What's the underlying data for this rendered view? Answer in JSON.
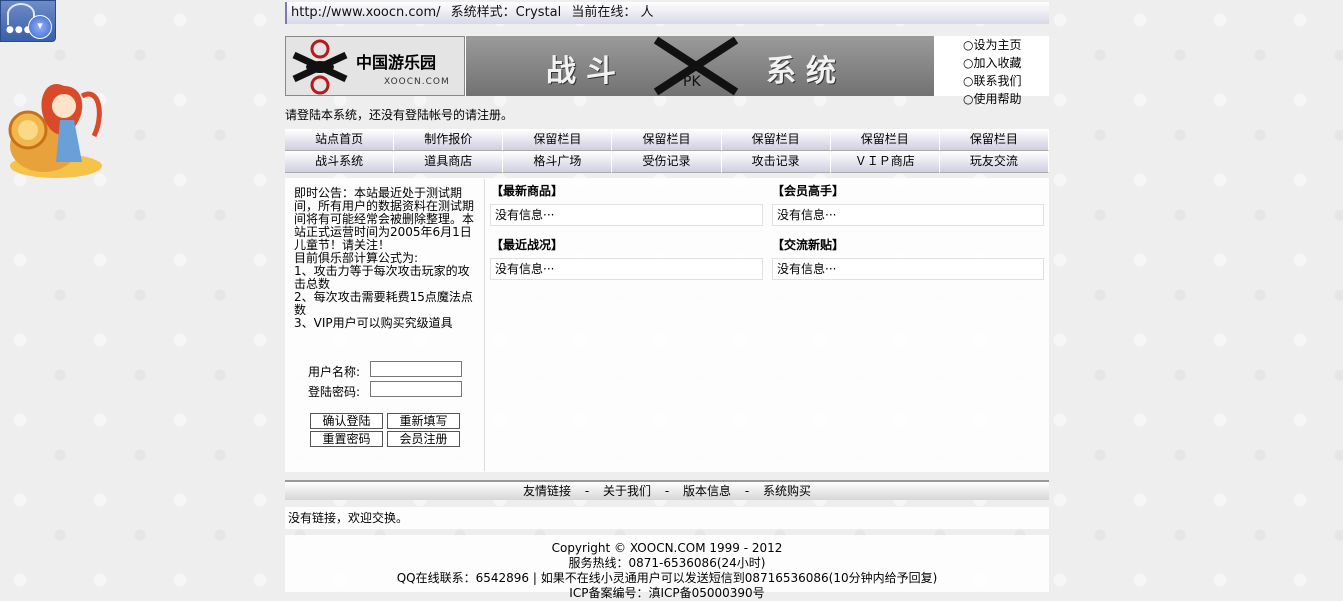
{
  "topbar": {
    "url": "http://www.xoocn.com/",
    "style": "系统样式：Crystal",
    "online": "当前在线：  人"
  },
  "banner": {
    "logo_cn": "中国游乐园",
    "logo_en": "XOOCN.COM",
    "title_left": "战斗",
    "title_right": "系统",
    "pk_label": "PK",
    "quick_links": [
      "○设为主页",
      "○加入收藏",
      "○联系我们",
      "○使用帮助"
    ]
  },
  "welcome": "请登陆本系统，还没有登陆帐号的请注册。",
  "nav_row1": [
    "站点首页",
    "制作报价",
    "保留栏目",
    "保留栏目",
    "保留栏目",
    "保留栏目",
    "保留栏目"
  ],
  "nav_row2": [
    "战斗系统",
    "道具商店",
    "格斗广场",
    "受伤记录",
    "攻击记录",
    "ＶＩＰ商店",
    "玩友交流"
  ],
  "notice": {
    "p1": "即时公告：本站最近处于测试期间，所有用户的数据资料在测试期间将有可能经常会被删除整理。本站正式运营时间为2005年6月1日儿童节！请关注！",
    "p2": "目前俱乐部计算公式为:",
    "p3": "1、攻击力等于每次攻击玩家的攻击总数",
    "p4": "2、每次攻击需要耗费15点魔法点数",
    "p5": "3、VIP用户可以购买究级道具"
  },
  "login": {
    "username_label": "用户名称:",
    "password_label": "登陆密码:",
    "confirm": "确认登陆",
    "reset": "重新填写",
    "reset_password": "重置密码",
    "register": "会员注册"
  },
  "sections": {
    "new_goods": {
      "title": "【最新商品】",
      "text": "没有信息···"
    },
    "top_members": {
      "title": "【会员高手】",
      "text": "没有信息···"
    },
    "recent_battles": {
      "title": "【最近战况】",
      "text": "没有信息···"
    },
    "new_posts": {
      "title": "【交流新贴】",
      "text": "没有信息···"
    }
  },
  "footer": {
    "links": [
      "友情链接",
      "关于我们",
      "版本信息",
      "系统购买"
    ],
    "separator": "-",
    "no_links": "没有链接，欢迎交换。",
    "copyright": "Copyright © XOOCN.COM 1999 - 2012",
    "hotline": "服务热线：0871-6536086(24小时)",
    "qq": "QQ在线联系：6542896 | 如果不在线小灵通用户可以发送短信到08716536086(10分钟内给予回复)",
    "icp": "ICP备案编号：滇ICP备05000390号"
  }
}
